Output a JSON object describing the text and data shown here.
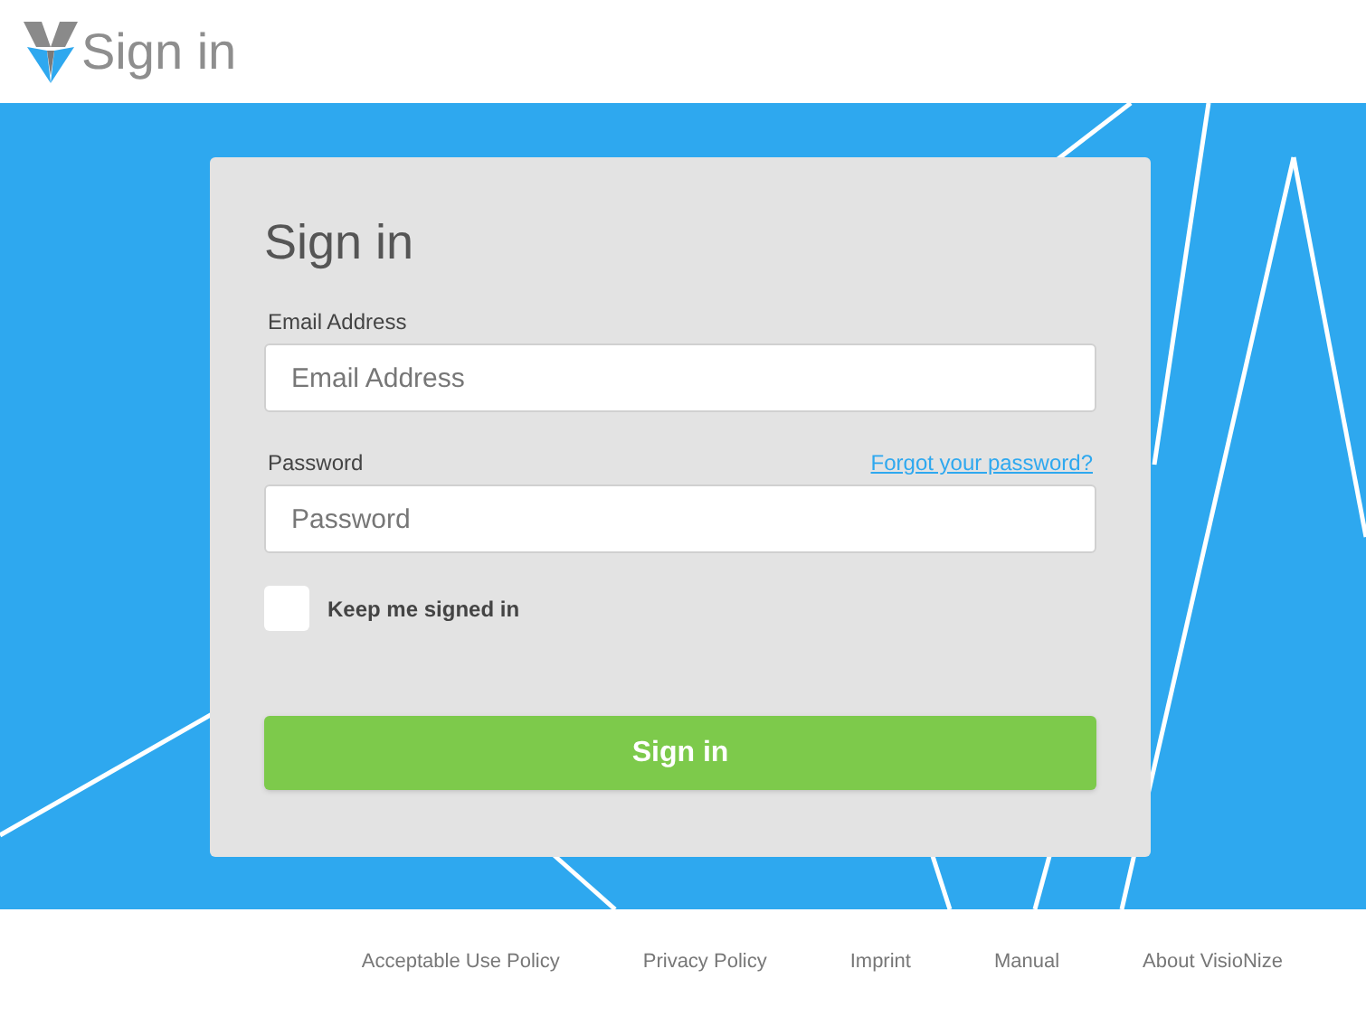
{
  "header": {
    "title": "Sign in"
  },
  "form": {
    "heading": "Sign in",
    "email": {
      "label": "Email Address",
      "placeholder": "Email Address"
    },
    "password": {
      "label": "Password",
      "placeholder": "Password",
      "forgot_link": "Forgot your password?"
    },
    "keep_signed_in": {
      "label": "Keep me signed in",
      "checked": false
    },
    "submit": "Sign in"
  },
  "footer_links": [
    "Acceptable Use Policy",
    "Privacy Policy",
    "Imprint",
    "Manual",
    "About VisioNize"
  ]
}
